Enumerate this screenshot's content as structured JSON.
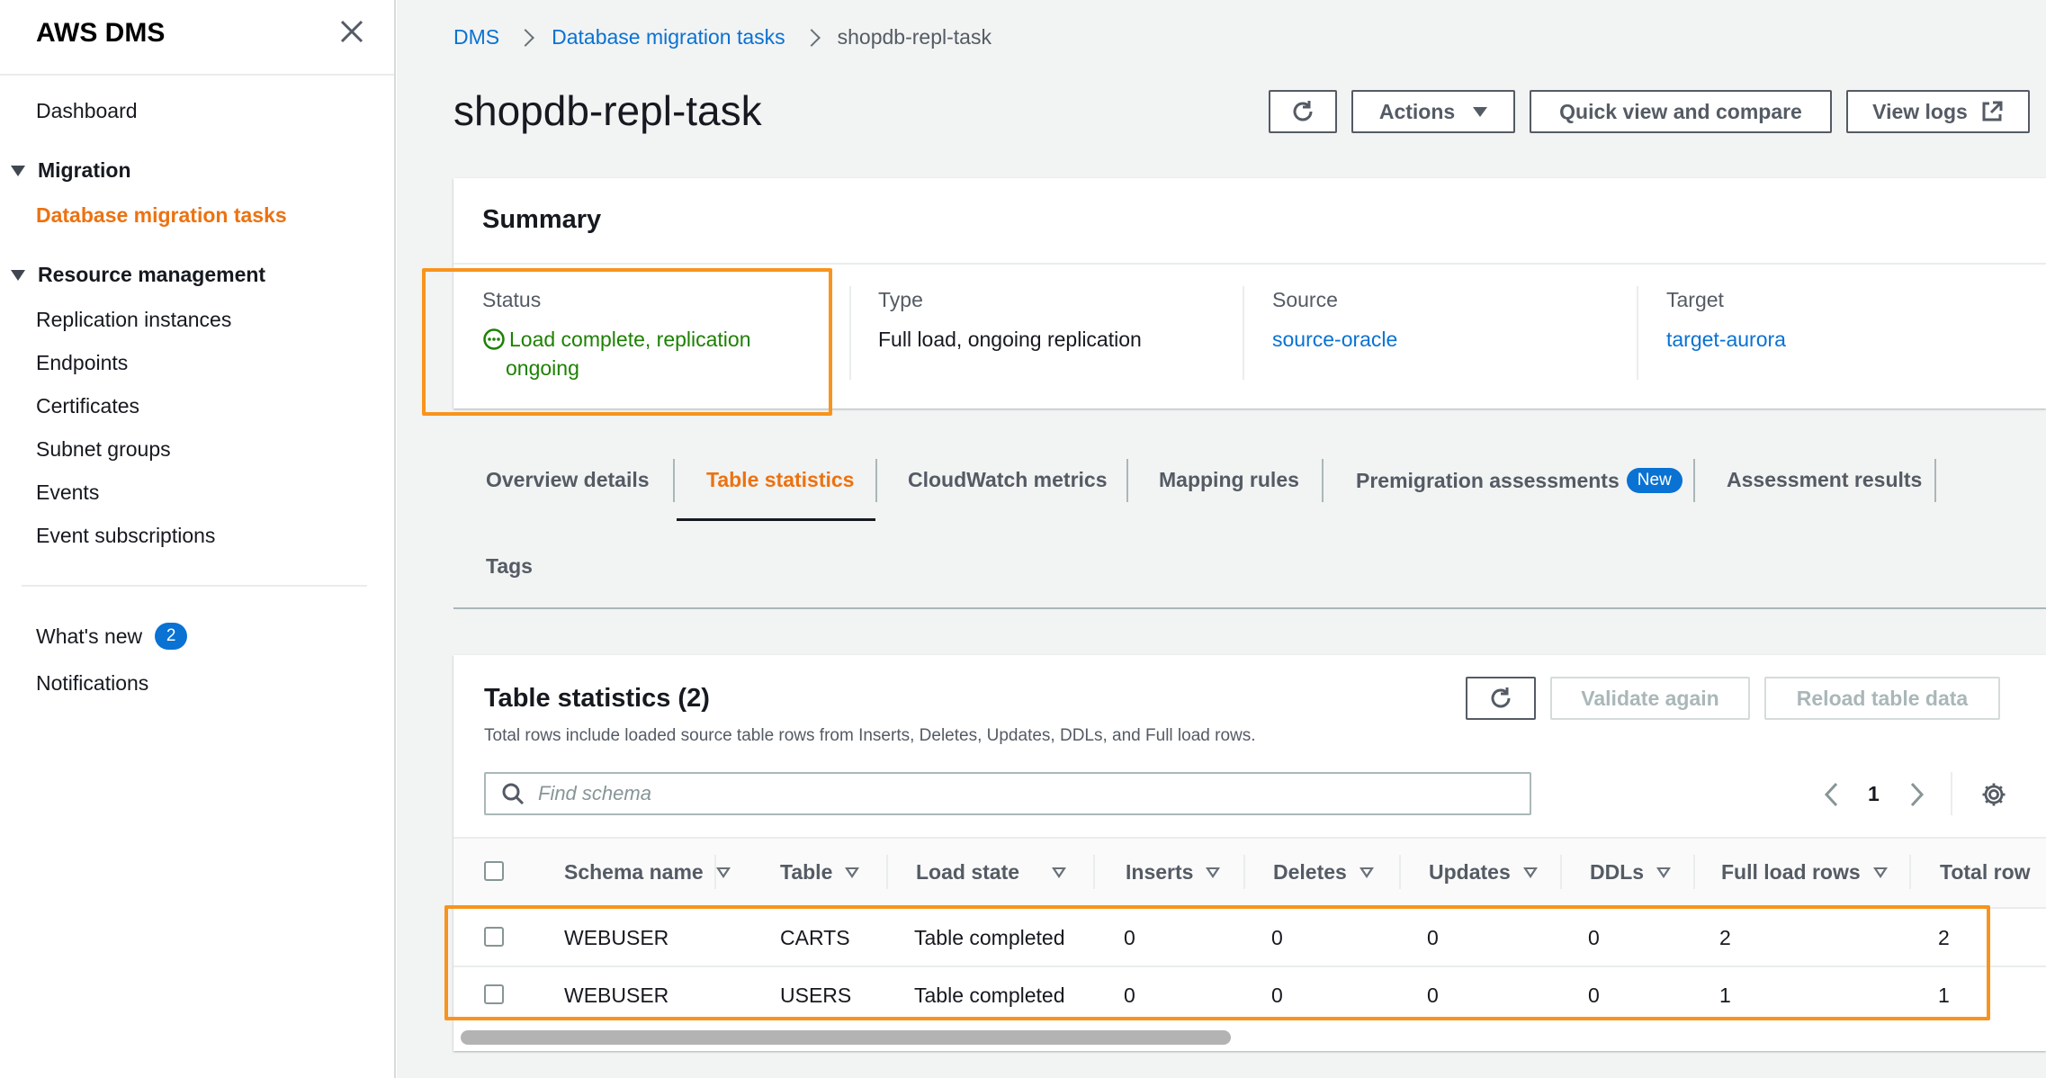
{
  "sidebar": {
    "title": "AWS DMS",
    "dashboard": "Dashboard",
    "migration_section": "Migration",
    "migration_items": [
      "Database migration tasks"
    ],
    "resource_section": "Resource management",
    "resource_items": [
      "Replication instances",
      "Endpoints",
      "Certificates",
      "Subnet groups",
      "Events",
      "Event subscriptions"
    ],
    "whats_new": "What's new",
    "whats_new_count": "2",
    "notifications": "Notifications"
  },
  "breadcrumbs": [
    "DMS",
    "Database migration tasks",
    "shopdb-repl-task"
  ],
  "page_title": "shopdb-repl-task",
  "header_buttons": {
    "actions": "Actions",
    "quick_view": "Quick view and compare",
    "view_logs": "View logs"
  },
  "summary": {
    "title": "Summary",
    "status_label": "Status",
    "status_value_line1": "Load complete, replication",
    "status_value_line2": "ongoing",
    "type_label": "Type",
    "type_value": "Full load, ongoing replication",
    "source_label": "Source",
    "source_value": "source-oracle",
    "target_label": "Target",
    "target_value": "target-aurora"
  },
  "tabs": {
    "overview": "Overview details",
    "table_stats": "Table statistics",
    "cloudwatch": "CloudWatch metrics",
    "mapping": "Mapping rules",
    "premigration": "Premigration assessments",
    "premigration_badge": "New",
    "assessment": "Assessment results",
    "tags": "Tags",
    "active": "Table statistics"
  },
  "table_stats": {
    "title": "Table statistics (2)",
    "description": "Total rows include loaded source table rows from Inserts, Deletes, Updates, DDLs, and Full load rows.",
    "validate_again": "Validate again",
    "reload": "Reload table data",
    "search_placeholder": "Find schema",
    "page": "1",
    "columns": [
      "Schema name",
      "Table",
      "Load state",
      "Inserts",
      "Deletes",
      "Updates",
      "DDLs",
      "Full load rows",
      "Total row"
    ],
    "rows": [
      [
        "WEBUSER",
        "CARTS",
        "Table completed",
        "0",
        "0",
        "0",
        "0",
        "2",
        "2"
      ],
      [
        "WEBUSER",
        "USERS",
        "Table completed",
        "0",
        "0",
        "0",
        "0",
        "1",
        "1"
      ]
    ]
  },
  "colors": {
    "accent_orange": "#ec7211",
    "link_blue": "#0972d3",
    "success_green": "#1d8102",
    "highlight_orange": "#f7941d"
  }
}
